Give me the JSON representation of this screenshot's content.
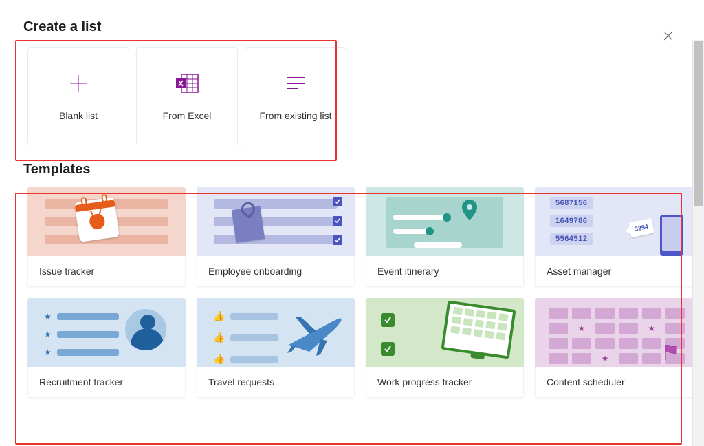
{
  "title": "Create a list",
  "sections": {
    "templates": "Templates"
  },
  "create": {
    "blank": {
      "label": "Blank list"
    },
    "excel": {
      "label": "From Excel"
    },
    "existing": {
      "label": "From existing list"
    }
  },
  "templates": {
    "issue": {
      "label": "Issue tracker"
    },
    "emp": {
      "label": "Employee onboarding"
    },
    "event": {
      "label": "Event itinerary"
    },
    "asset": {
      "label": "Asset manager",
      "tags": [
        "5687156",
        "1649786",
        "5564512"
      ],
      "price": "3254"
    },
    "recruit": {
      "label": "Recruitment tracker"
    },
    "travel": {
      "label": "Travel requests"
    },
    "work": {
      "label": "Work progress tracker"
    },
    "content": {
      "label": "Content scheduler"
    }
  }
}
